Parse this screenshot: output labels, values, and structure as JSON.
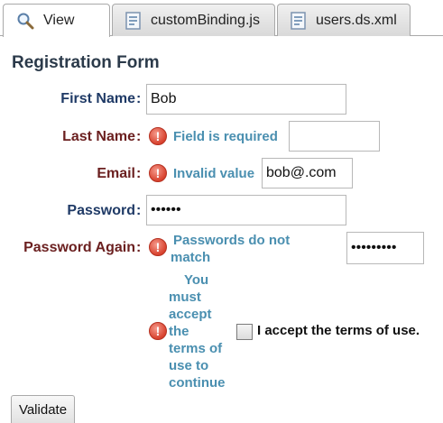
{
  "tabs": [
    {
      "label": "View",
      "icon": "search-icon",
      "active": true
    },
    {
      "label": "customBinding.js",
      "icon": "file-icon",
      "active": false
    },
    {
      "label": "users.ds.xml",
      "icon": "file-icon",
      "active": false
    }
  ],
  "form": {
    "title": "Registration Form",
    "colon": ":",
    "error_icon_glyph": "!",
    "first_name": {
      "label": "First Name",
      "value": ""
    },
    "last_name": {
      "label": "Last Name",
      "error": "Field is required",
      "value": ""
    },
    "email": {
      "label": "Email",
      "error": "Invalid value",
      "value": "bob@.com"
    },
    "password": {
      "label": "Password",
      "value": "••••••"
    },
    "password_again": {
      "label": "Password Again",
      "error_line1": "Passwords do not",
      "error_line2": "match",
      "value": "•••••••••"
    },
    "terms": {
      "error_lines": [
        "You",
        "must",
        "accept",
        "the",
        "terms of",
        "use to",
        "continue"
      ],
      "checkbox_label": "I accept the terms of use.",
      "checked": false
    },
    "first_name_value": "Bob",
    "validate_label": "Validate"
  },
  "colors": {
    "label_ok": "#1f3a66",
    "label_error": "#6b2020",
    "error_text": "#4a8fb0",
    "error_icon": "#d8422e"
  }
}
